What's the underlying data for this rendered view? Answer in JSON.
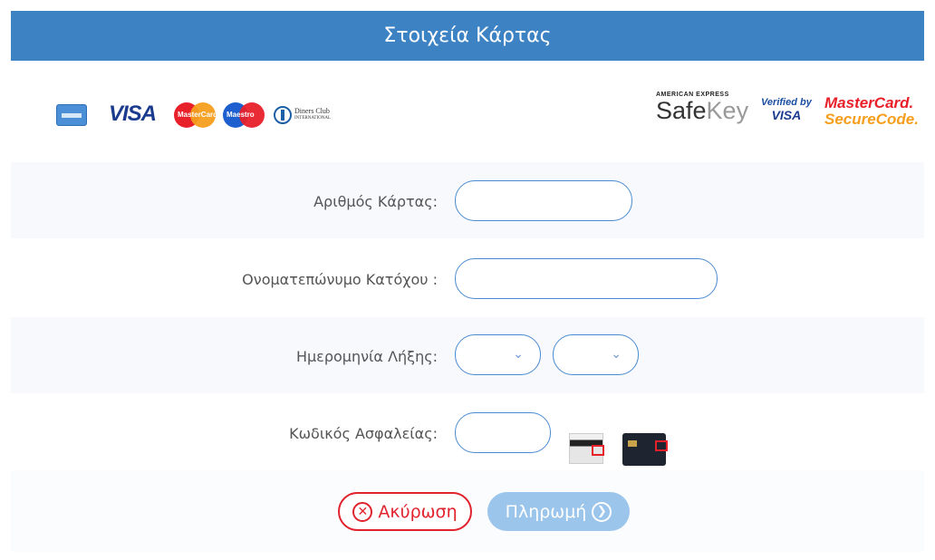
{
  "header": {
    "title": "Στοιχεία Κάρτας"
  },
  "logos": {
    "visa": "VISA",
    "mastercard_text": "MasterCard",
    "maestro_text": "Maestro",
    "diners_line1": "Diners Club",
    "diners_line2": "INTERNATIONAL",
    "safekey_top": "AMERICAN EXPRESS",
    "safekey_a": "Safe",
    "safekey_b": "Key",
    "vbv_top": "Verified by",
    "vbv_visa": "VISA",
    "msc_top": "MasterCard.",
    "msc_bottom": "SecureCode."
  },
  "form": {
    "card_number_label": "Αριθμός Κάρτας:",
    "card_number_value": "",
    "holder_label": "Ονοματεπώνυμο Κατόχου :",
    "holder_value": "",
    "expiry_label": "Ημερομηνία Λήξης:",
    "expiry_month": "",
    "expiry_year": "",
    "cvv_label": "Κωδικός Ασφαλείας:",
    "cvv_value": ""
  },
  "buttons": {
    "cancel_label": "Ακύρωση",
    "pay_label": "Πληρωμή"
  },
  "colors": {
    "header_bg": "#3d83c4",
    "cancel": "#e0232d",
    "pay_bg": "#9cc5eb",
    "field_border": "#4a8ad0"
  }
}
